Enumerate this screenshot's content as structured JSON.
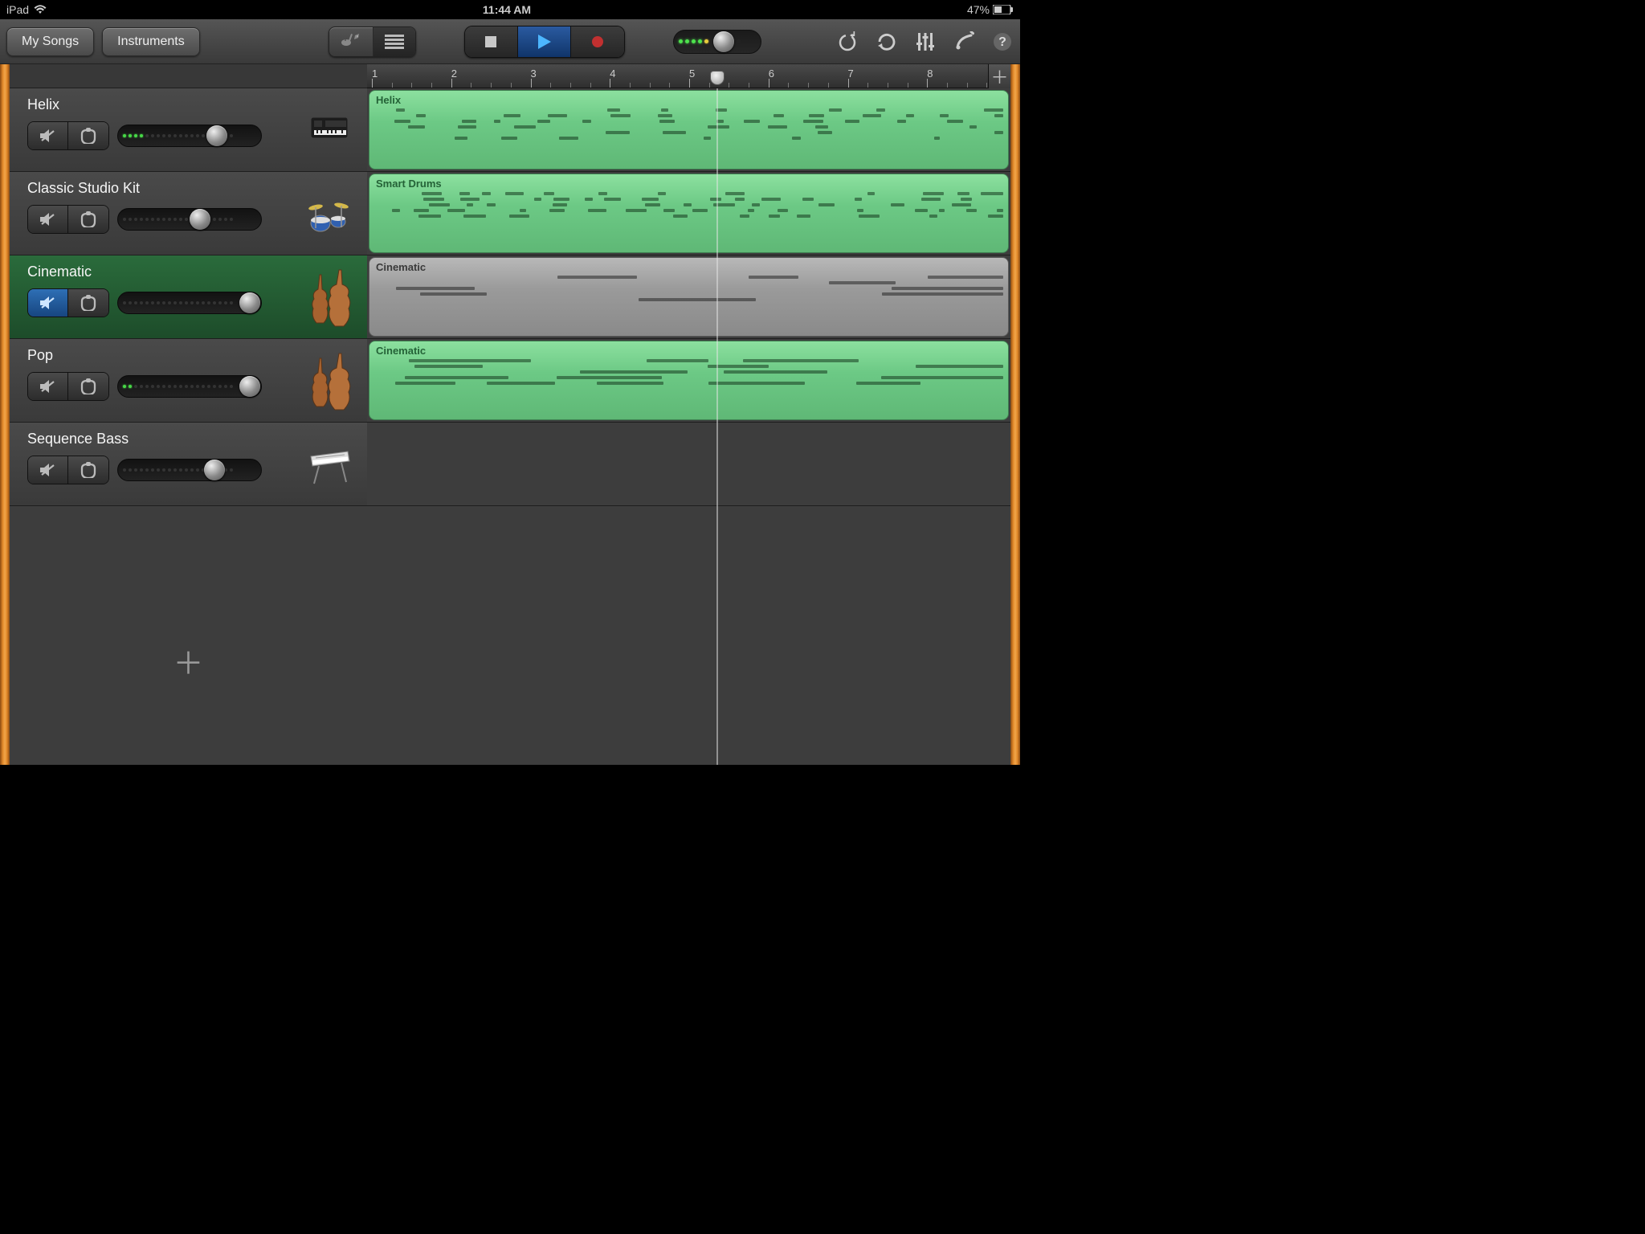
{
  "statusbar": {
    "device": "iPad",
    "time": "11:44 AM",
    "battery": "47%"
  },
  "toolbar": {
    "my_songs": "My Songs",
    "instruments": "Instruments"
  },
  "ruler": {
    "marks": [
      "1",
      "2",
      "3",
      "4",
      "5",
      "6",
      "7",
      "8"
    ],
    "playhead_bar": 5.35
  },
  "master_volume": {
    "lit_leds": 5,
    "knob_pos": 0.46
  },
  "tracks": [
    {
      "name": "Helix",
      "muted": false,
      "selected": false,
      "instrument": "synth",
      "vol_lit": 4,
      "knob": 0.62,
      "region": {
        "label": "Helix",
        "color": "green"
      }
    },
    {
      "name": "Classic Studio Kit",
      "muted": false,
      "selected": false,
      "instrument": "drums",
      "vol_lit": 0,
      "knob": 0.5,
      "region": {
        "label": "Smart Drums",
        "color": "green"
      }
    },
    {
      "name": "Cinematic",
      "muted": true,
      "selected": true,
      "instrument": "strings",
      "vol_lit": 0,
      "knob": 0.85,
      "region": {
        "label": "Cinematic",
        "color": "gray"
      }
    },
    {
      "name": "Pop",
      "muted": false,
      "selected": false,
      "instrument": "strings",
      "vol_lit": 2,
      "knob": 0.85,
      "region": {
        "label": "Cinematic",
        "color": "green"
      }
    },
    {
      "name": "Sequence Bass",
      "muted": false,
      "selected": false,
      "instrument": "keyboard",
      "vol_lit": 0,
      "knob": 0.6,
      "region": null
    }
  ]
}
